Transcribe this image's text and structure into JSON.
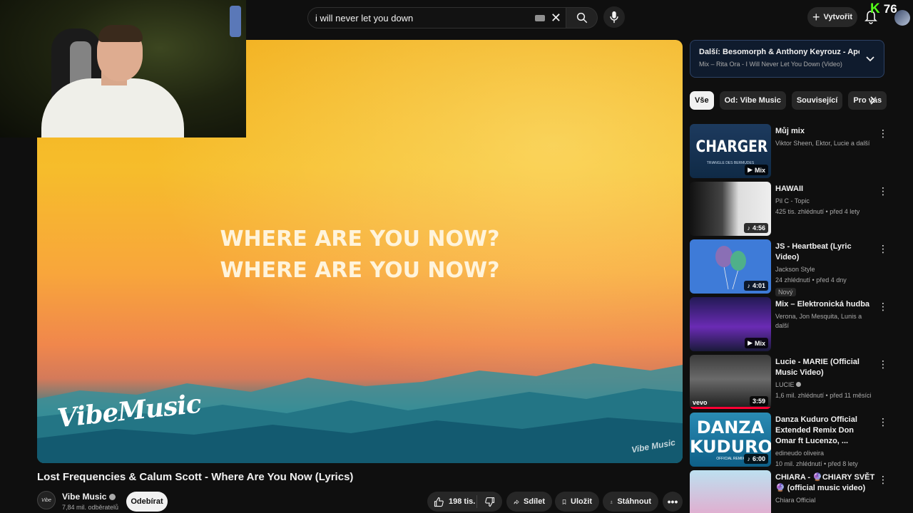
{
  "search": {
    "query": "i will never let you down"
  },
  "header": {
    "create_label": "Vytvořit",
    "kick_count": "76",
    "kick_letter": "K"
  },
  "video": {
    "lyrics_line1": "WHERE ARE YOU NOW?",
    "lyrics_line2": "WHERE ARE YOU NOW?",
    "logo_text": "VibeMusic",
    "corner_logo": "Vibe Music",
    "title": "Lost Frequencies & Calum Scott - Where Are You Now (Lyrics)"
  },
  "channel": {
    "name": "Vibe Music",
    "subscribers": "7,84 mil. odběratelů",
    "subscribe_label": "Odebírat",
    "avatar_text": "Vibe"
  },
  "actions": {
    "likes": "198 tis.",
    "share": "Sdílet",
    "save": "Uložit",
    "download": "Stáhnout",
    "more": "•••"
  },
  "next": {
    "title": "Další: Besomorph & Anthony Keyrouz - Apologize (f...",
    "subtitle": "Mix – Rita Ora - I Will Never Let You Down (Video)"
  },
  "chips": [
    "Vše",
    "Od: Vibe Music",
    "Související",
    "Pro vás"
  ],
  "recommendations": [
    {
      "title": "Můj mix",
      "channel": "Viktor Sheen, Ektor, Lucie a další",
      "meta": "",
      "badge": "Mix",
      "thumb_big": "CHARGER",
      "thumb_small": "TRIANGLE DES BERMUDES"
    },
    {
      "title": "HAWAII",
      "channel": "Pil C - Topic",
      "meta": "425 tis. zhlédnutí • před 4 lety",
      "badge": "4:56"
    },
    {
      "title": "JS - Heartbeat (Lyric Video)",
      "channel": "Jackson Style",
      "meta": "24 zhlédnutí • před 4 dny",
      "badge": "4:01",
      "new": "Nový"
    },
    {
      "title": "Mix – Elektronická hudba",
      "channel": "Verona, Jon Mesquita, Lunis a další",
      "meta": "",
      "badge": "Mix"
    },
    {
      "title": "Lucie - MARIE (Official Music Video)",
      "channel": "LUCIE",
      "meta": "1,6 mil. zhlédnutí • před 11 měsíci",
      "badge": "3:59",
      "vevo": "vevo"
    },
    {
      "title": "Danza Kuduro Official Extended Remix Don Omar ft Lucenzo, ...",
      "channel": "edineudo oliveira",
      "meta": "10 mil. zhlédnutí • před 8 lety",
      "badge": "6:00",
      "thumb_big": "DANZA KUDURO",
      "thumb_small": "OFFICIAL REMIX"
    },
    {
      "title": "CHIARA - 🔮CHIARY SVĚT🔮 (official music video)",
      "channel": "Chiara Official",
      "meta": ""
    }
  ]
}
